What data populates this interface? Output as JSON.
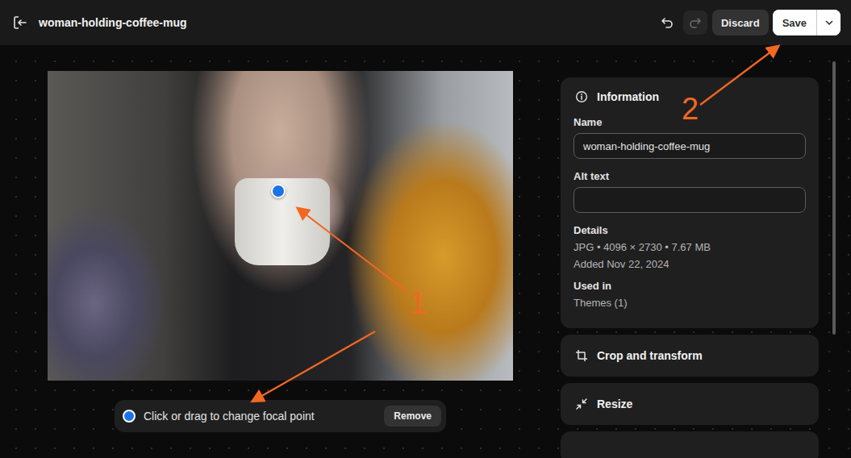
{
  "header": {
    "title": "woman-holding-coffee-mug",
    "undo_disabled": false,
    "redo_disabled": true,
    "discard": "Discard",
    "save": "Save"
  },
  "focal_toolbar": {
    "hint": "Click or drag to change focal point",
    "button": "Remove"
  },
  "information": {
    "title": "Information",
    "fields": [
      {
        "label": "Name",
        "value": "woman-holding-coffee-mug"
      },
      {
        "label": "Alt text",
        "value": ""
      }
    ],
    "details_label": "Details",
    "details": [
      "JPG • 4096 × 2730 • 7.67 MB",
      "Added Nov 22, 2024"
    ],
    "used_in_label": "Used in",
    "used_in": "Themes (1)"
  },
  "sections": [
    {
      "title": "Crop and transform",
      "kind": "crop"
    },
    {
      "title": "Resize",
      "kind": "resize"
    }
  ],
  "annotations": [
    {
      "label": "1"
    },
    {
      "label": "2"
    }
  ]
}
